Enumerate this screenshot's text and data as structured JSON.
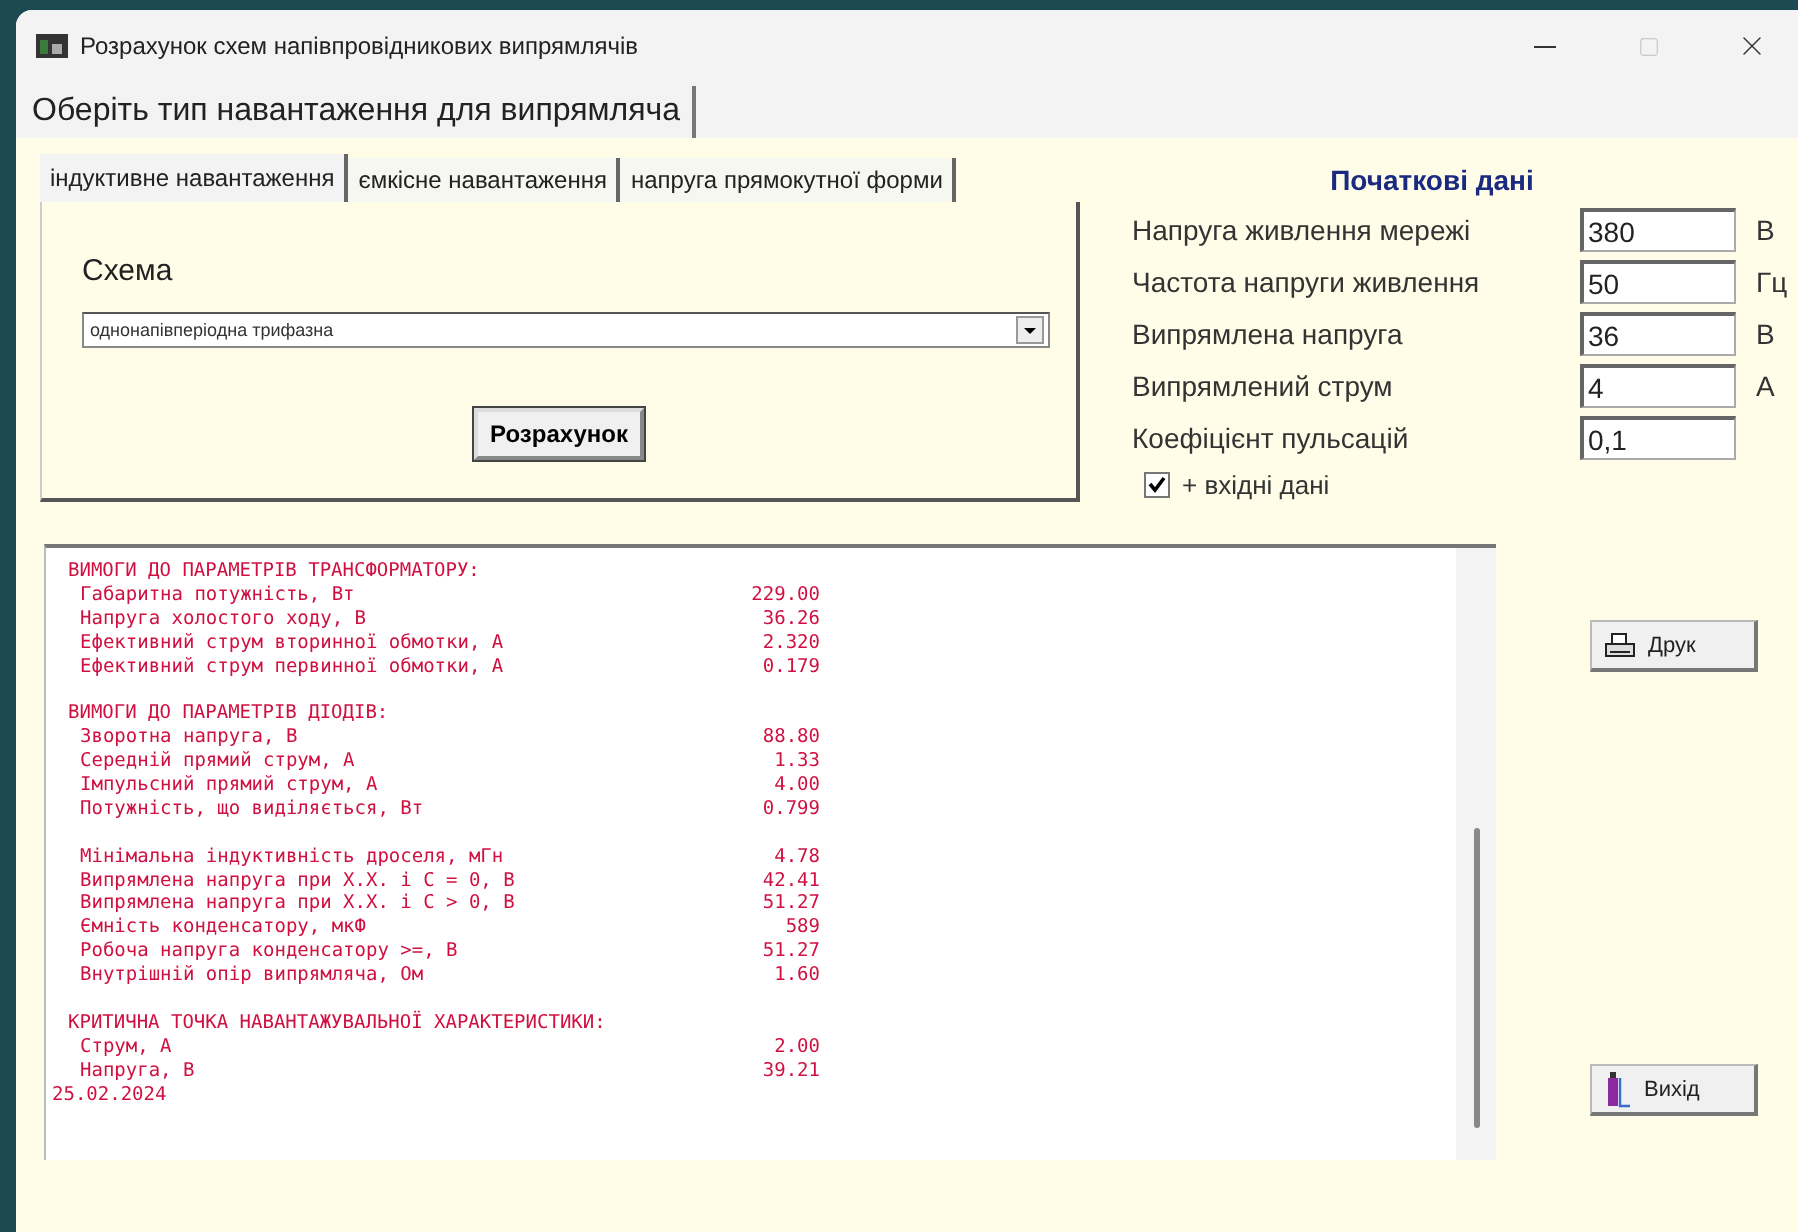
{
  "window": {
    "title": "Розрахунок схем напівпровідникових випрямлячів"
  },
  "top_tabs": [
    {
      "label": "Оберіть тип навантаження для випрямляча",
      "selected": true
    }
  ],
  "load_tabs": [
    {
      "label": "індуктивне навантаження",
      "selected": true
    },
    {
      "label": "ємкісне навантаження",
      "selected": false
    },
    {
      "label": "напруга прямокутної форми",
      "selected": false
    }
  ],
  "scheme": {
    "label": "Схема",
    "value": "однонапівперіодна трифазна"
  },
  "calculate_button": "Розрахунок",
  "initial_data": {
    "title": "Початкові дані",
    "fields": [
      {
        "label": "Напруга живлення мережі",
        "value": "380",
        "unit": "В"
      },
      {
        "label": "Частота напруги живлення",
        "value": "50",
        "unit": "Гц"
      },
      {
        "label": "Випрямлена напруга",
        "value": "36",
        "unit": "В"
      },
      {
        "label": "Випрямлений струм",
        "value": "4",
        "unit": "А"
      },
      {
        "label": "Коефіцієнт пульсацій",
        "value": "0,1"
      }
    ]
  },
  "include_input": {
    "label": "+ вхідні дані",
    "checked": true
  },
  "report": [
    {
      "kind": "heading",
      "text": "ВИМОГИ ДО ПАРАМЕТРІВ ТРАНСФОРМАТОРУ:"
    },
    {
      "kind": "item",
      "text": "Габаритна потужність, Вт",
      "value": "229.00"
    },
    {
      "kind": "item",
      "text": "Напруга холостого ходу, В",
      "value": "36.26"
    },
    {
      "kind": "item",
      "text": "Ефективний струм вторинної обмотки, А",
      "value": "2.320"
    },
    {
      "kind": "item",
      "text": "Ефективний струм первинної обмотки, А",
      "value": "0.179"
    },
    {
      "kind": "blank"
    },
    {
      "kind": "heading",
      "text": "ВИМОГИ ДО ПАРАМЕТРІВ ДІОДІВ:"
    },
    {
      "kind": "item",
      "text": "Зворотна напруга, В",
      "value": "88.80"
    },
    {
      "kind": "item",
      "text": "Середній прямий струм, А",
      "value": "1.33"
    },
    {
      "kind": "item",
      "text": "Імпульсний прямий струм, А",
      "value": "4.00"
    },
    {
      "kind": "item",
      "text": "Потужність, що виділяється, Вт",
      "value": "0.799"
    },
    {
      "kind": "blank"
    },
    {
      "kind": "item",
      "text": "Мінімальна індуктивність дроселя, мГн",
      "value": "4.78"
    },
    {
      "kind": "item",
      "text": "Випрямлена напруга при Х.Х. і С = 0, В",
      "value": "42.41"
    },
    {
      "kind": "item",
      "text": "Випрямлена напруга при Х.Х. і С > 0, В",
      "value": "51.27"
    },
    {
      "kind": "item",
      "text": "Ємність конденсатору, мкФ",
      "value": "589"
    },
    {
      "kind": "item",
      "text": "Робоча напруга конденсатору >=, В",
      "value": "51.27"
    },
    {
      "kind": "item",
      "text": "Внутрішній опір випрямляча, Ом",
      "value": "1.60"
    },
    {
      "kind": "blank"
    },
    {
      "kind": "heading",
      "text": "КРИТИЧНА ТОЧКА НАВАНТАЖУВАЛЬНОЇ ХАРАКТЕРИСТИКИ:"
    },
    {
      "kind": "item",
      "text": "Струм, А",
      "value": "2.00"
    },
    {
      "kind": "item",
      "text": "Напруга, В",
      "value": "39.21"
    },
    {
      "kind": "date",
      "text": "25.02.2024"
    }
  ],
  "print_button": "Друк",
  "exit_button": "Вихід"
}
